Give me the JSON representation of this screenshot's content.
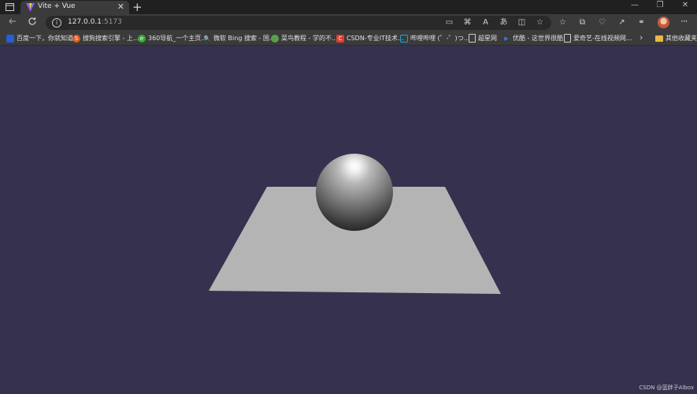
{
  "browser": {
    "tab": {
      "title": "Vite + Vue",
      "close": "✕"
    },
    "new_tab": "+",
    "window_controls": {
      "minimize": "—",
      "restore": "❐",
      "close": "✕"
    },
    "address": {
      "host": "127.0.0.1",
      "port": ":5173"
    },
    "profile_more": "···"
  },
  "bookmarks": [
    {
      "label": "百度一下，你就知道",
      "icon": "baidu-icon",
      "color": "#2a5bd7"
    },
    {
      "label": "搜狗搜索引擎 - 上...",
      "icon": "sogou-icon",
      "color": "#e05a1c"
    },
    {
      "label": "360导航_一个主页...",
      "icon": "360-icon",
      "color": "#3aa83a"
    },
    {
      "label": "微软 Bing 搜索 - 国...",
      "icon": "bing-icon",
      "color": "#1e7fd6"
    },
    {
      "label": "菜鸟教程 - 学的不...",
      "icon": "runoob-icon",
      "color": "#5aa04a"
    },
    {
      "label": "CSDN-专业IT技术...",
      "icon": "csdn-icon",
      "color": "#e23c2e"
    },
    {
      "label": "哔哩哔哩 (゜-゜)つ...",
      "icon": "bilibili-icon",
      "color": "#1aa4d6"
    },
    {
      "label": "超星网",
      "icon": "page-icon",
      "color": "#9a9a9a"
    },
    {
      "label": "优酷 - 这世界很酷",
      "icon": "youku-icon",
      "color": "#3a7be0"
    },
    {
      "label": "爱奇艺-在线视频网...",
      "icon": "page-icon",
      "color": "#9a9a9a"
    }
  ],
  "bookmarks_overflow": "›",
  "other_bookmarks": "其他收藏夹",
  "scene": {
    "background": "#35314e",
    "plane_color": "#b4b4b4",
    "sphere_color": "#9a9a9a"
  },
  "watermark": "CSDN @蓝胖子Albox"
}
